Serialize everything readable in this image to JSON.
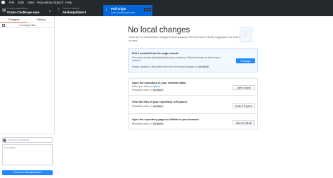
{
  "menu": {
    "items": [
      "File",
      "Edit",
      "View",
      "Repository",
      "Branch",
      "Help"
    ]
  },
  "toolbar": {
    "repo_label": "Current repository",
    "repo_name": "Crater-Challenge-repo",
    "branch_label": "Current branch",
    "branch_name": "Akshatpatilwar1",
    "push_title": "Pull origin",
    "push_sub": "Last fetched just now",
    "push_shortcut": "Ctrl P"
  },
  "left": {
    "tabs": [
      "Changes",
      "History"
    ],
    "changed_files": "0 changed files",
    "summary_placeholder": "Summary (required)",
    "description_placeholder": "Description",
    "commit_button": "Commit to Akshatpatilwar1"
  },
  "main": {
    "title": "No local changes",
    "subtitle": "There are no uncommitted changes in this repository. Here are some friendly suggestions for what to do next.",
    "cards": [
      {
        "title": "Pull 1 commit from the origin remote",
        "text": "The current branch (Akshatpatilwar1) has a commit on GitHub that does not exist on your machine.",
        "hint": "Always available in the toolbar when there are remote changes or",
        "hint_keys": "Ctrl Shift P",
        "button": "Pull origin"
      },
      {
        "title": "Open the repository in your external editor",
        "text_prefix": "Select your editor in",
        "text_link": "Options",
        "hint": "Repository menu or",
        "hint_keys": "Ctrl Shift A",
        "button": "Open in Atom"
      },
      {
        "title": "View the files of your repository in Explorer",
        "hint": "Repository menu or",
        "hint_keys": "Ctrl Shift F",
        "button": "Show in Explorer"
      },
      {
        "title": "Open the repository page on GitHub in your browser",
        "hint": "Repository menu or",
        "hint_keys": "Ctrl Shift G",
        "button": "View on GitHub"
      }
    ]
  },
  "colors": {
    "titlebar": "#24292e",
    "accent": "#0366d6",
    "button_blue": "#2188ff",
    "tab_underline": "#f9826c"
  }
}
